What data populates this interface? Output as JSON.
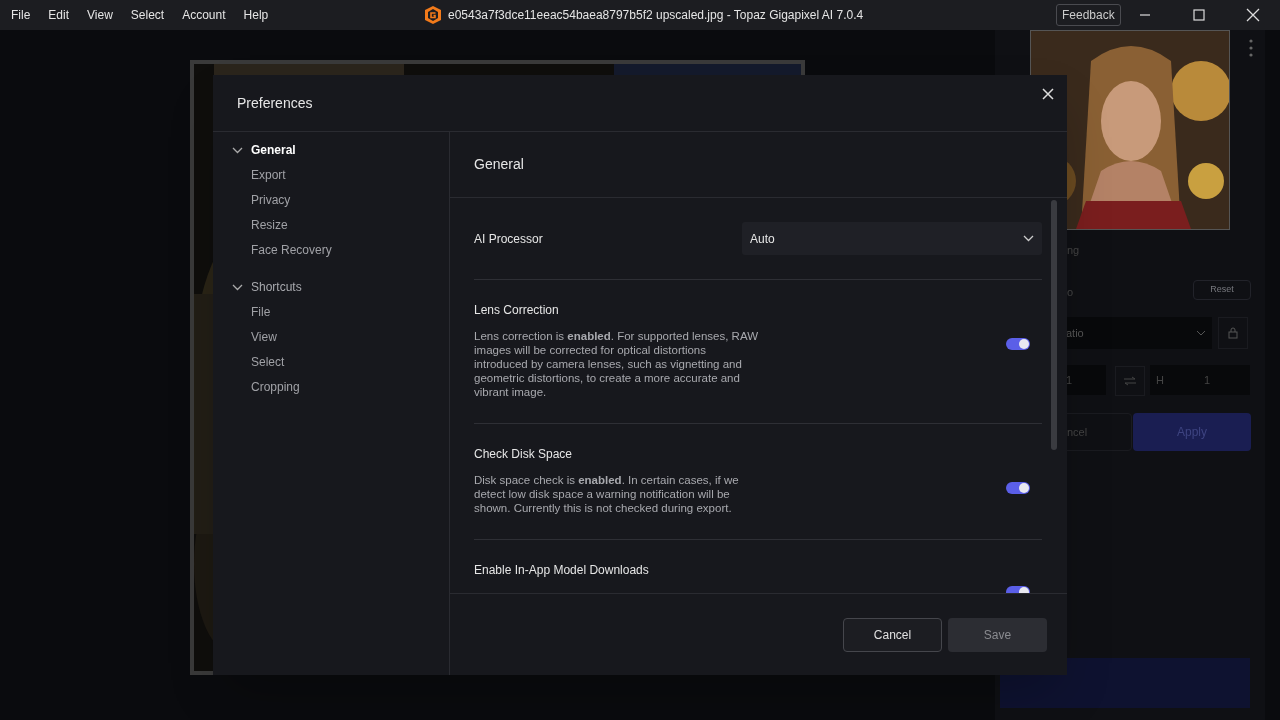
{
  "menu": [
    "File",
    "Edit",
    "View",
    "Select",
    "Account",
    "Help"
  ],
  "window": {
    "title": "e0543a7f3dce11eeac54baea8797b5f2 upscaled.jpg - Topaz Gigapixel AI 7.0.4",
    "feedback": "Feedback"
  },
  "background_panel": {
    "texts": [
      "ng",
      "o"
    ],
    "reset": "Reset",
    "ratio": "atio",
    "width_value": "1",
    "height_label": "H",
    "height_value": "1",
    "cancel": "ncel",
    "apply": "Apply"
  },
  "dialog": {
    "title": "Preferences",
    "nav": [
      {
        "label": "General",
        "selected": true,
        "children": [
          {
            "label": "Export"
          },
          {
            "label": "Privacy"
          },
          {
            "label": "Resize"
          },
          {
            "label": "Face Recovery"
          }
        ]
      },
      {
        "label": "Shortcuts",
        "selected": false,
        "children": [
          {
            "label": "File"
          },
          {
            "label": "View"
          },
          {
            "label": "Select"
          },
          {
            "label": "Cropping"
          }
        ]
      }
    ],
    "section_title": "General",
    "settings": [
      {
        "kind": "dropdown",
        "label": "AI Processor",
        "value": "Auto"
      },
      {
        "kind": "toggle",
        "label": "Lens Correction",
        "description": "Lens correction is **enabled**. For supported lenses, RAW images will be corrected for optical distortions introduced by camera lenses, such as vignetting and geometric distortions, to create a more accurate and vibrant image.",
        "on": true
      },
      {
        "kind": "toggle",
        "label": "Check Disk Space",
        "description": "Disk space check is **enabled**. In certain cases, if we detect low disk space a warning notification will be shown. Currently this is not checked during export.",
        "on": true
      },
      {
        "kind": "toggle",
        "label": "Enable In-App Model Downloads",
        "on": true
      }
    ],
    "buttons": [
      {
        "label": "Cancel",
        "kind": "secondary"
      },
      {
        "label": "Save",
        "kind": "primary"
      }
    ]
  }
}
